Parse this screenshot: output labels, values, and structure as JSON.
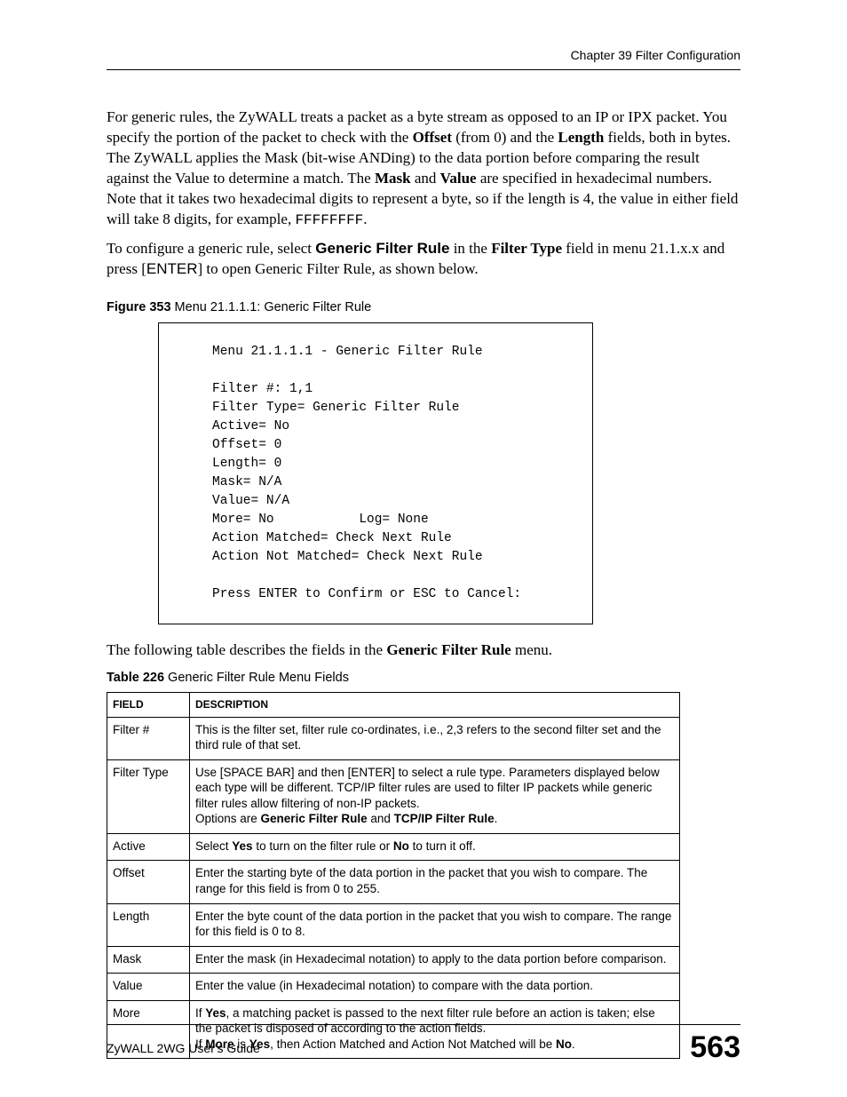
{
  "header": {
    "chapter": "Chapter 39 Filter Configuration"
  },
  "intro": {
    "para1_parts": [
      "For generic rules, the ZyWALL treats a packet as a byte stream as opposed to an IP or IPX packet. You specify the portion of the packet to check with the ",
      "Offset",
      " (from 0) and the ",
      "Length",
      " fields, both in bytes. The ZyWALL applies the Mask (bit-wise ANDing) to the data portion before comparing the result against the Value to determine a match. The ",
      "Mask",
      " and ",
      "Value",
      " are specified in hexadecimal numbers. Note that it takes two hexadecimal digits to represent a byte, so if the length is 4, the value in either field will take 8 digits, for example, ",
      "FFFFFFFF",
      "."
    ],
    "para2_parts": [
      "To configure a generic rule, select ",
      "Generic Filter Rule",
      " in the ",
      "Filter Type",
      " field in menu 21.1.x.x and press [",
      "ENTER",
      "] to open Generic Filter Rule, as shown below."
    ]
  },
  "figure": {
    "label_bold": "Figure 353",
    "label_rest": "   Menu 21.1.1.1: Generic Filter Rule",
    "content": "Menu 21.1.1.1 - Generic Filter Rule\n\nFilter #: 1,1\nFilter Type= Generic Filter Rule\nActive= No\nOffset= 0\nLength= 0\nMask= N/A\nValue= N/A\nMore= No           Log= None\nAction Matched= Check Next Rule\nAction Not Matched= Check Next Rule\n\nPress ENTER to Confirm or ESC to Cancel:"
  },
  "table_intro_parts": [
    "The following table describes the fields in the ",
    "Generic Filter Rule",
    " menu."
  ],
  "table": {
    "label_bold": "Table 226",
    "label_rest": "   Generic Filter Rule Menu Fields",
    "headers": {
      "col1": "FIELD",
      "col2": "DESCRIPTION"
    },
    "rows": [
      {
        "field": "Filter #",
        "desc_html": "This is the filter set, filter rule co-ordinates, i.e., 2,3 refers to the second filter set and the third rule of that set."
      },
      {
        "field": "Filter Type",
        "desc_html": "Use [SPACE BAR] and then [ENTER] to select a rule type. Parameters displayed below each type will be different. TCP/IP filter rules are used to filter IP packets while generic filter rules allow filtering of non-IP packets.<br>Options are <b>Generic Filter Rule</b> and <b>TCP/IP Filter Rule</b>."
      },
      {
        "field": "Active",
        "desc_html": "Select <b>Yes</b> to turn on the filter rule or <b>No</b> to turn it off."
      },
      {
        "field": "Offset",
        "desc_html": "Enter the starting byte of the data portion in the packet that you wish to compare. The range for this field is from 0 to 255."
      },
      {
        "field": "Length",
        "desc_html": "Enter the byte count of the data portion in the packet that you wish to compare. The range for this field is 0 to 8."
      },
      {
        "field": "Mask",
        "desc_html": "Enter the mask (in Hexadecimal notation) to apply to the data portion before comparison."
      },
      {
        "field": "Value",
        "desc_html": "Enter the value (in Hexadecimal notation) to compare with the data portion."
      },
      {
        "field": "More",
        "desc_html": "If <b>Yes</b>, a matching packet is passed to the next filter rule before an action is taken; else the packet is disposed of according to the action fields.<br>If <b>More</b> is <b>Yes</b>, then Action Matched and Action Not Matched will be <b>No</b>."
      }
    ]
  },
  "footer": {
    "guide": "ZyWALL 2WG User's Guide",
    "page": "563"
  }
}
